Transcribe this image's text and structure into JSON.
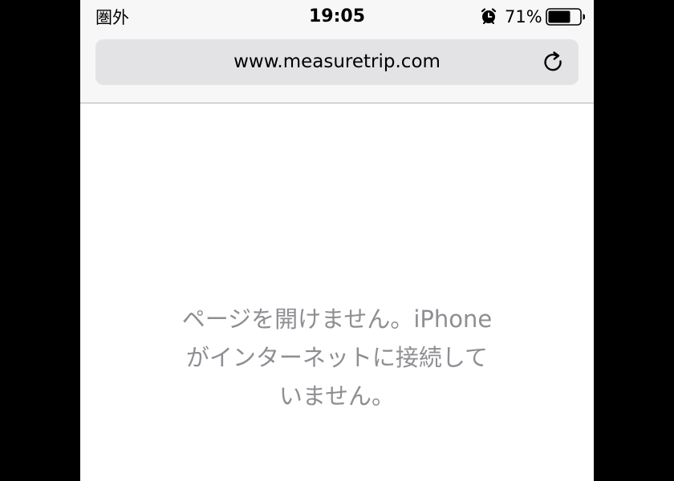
{
  "status_bar": {
    "carrier": "圏外",
    "time": "19:05",
    "battery_percent": "71%",
    "battery_level": 0.71,
    "alarm_icon": "alarm-clock-icon",
    "battery_icon": "battery-icon"
  },
  "address_bar": {
    "url": "www.measuretrip.com",
    "reload_icon": "reload-icon"
  },
  "error_page": {
    "lines": [
      "ページを開けません。iPhone",
      "がインターネットに接続して",
      "いません。"
    ]
  },
  "colors": {
    "chrome_background": "#f7f7f7",
    "address_bar_background": "#e3e3e5",
    "error_text": "#8e8e93"
  }
}
